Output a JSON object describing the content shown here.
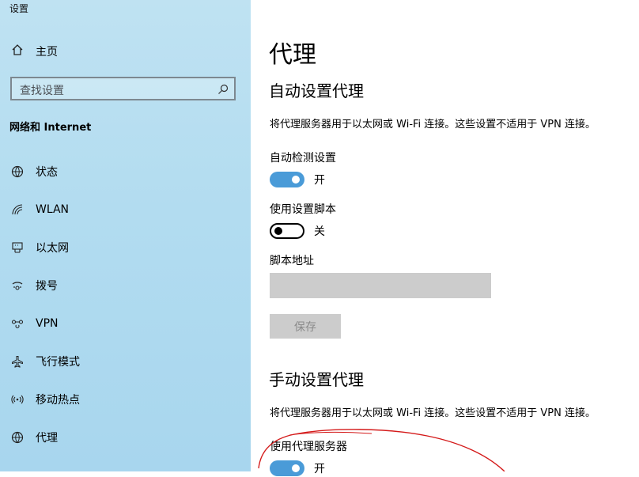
{
  "window": {
    "title": "设置"
  },
  "sidebar": {
    "home_label": "主页",
    "search_placeholder": "查找设置",
    "section_title": "网络和 Internet",
    "items": [
      {
        "label": "状态",
        "icon": "globe-icon"
      },
      {
        "label": "WLAN",
        "icon": "wifi-icon"
      },
      {
        "label": "以太网",
        "icon": "ethernet-icon"
      },
      {
        "label": "拨号",
        "icon": "dialup-icon"
      },
      {
        "label": "VPN",
        "icon": "vpn-icon"
      },
      {
        "label": "飞行模式",
        "icon": "airplane-icon"
      },
      {
        "label": "移动热点",
        "icon": "hotspot-icon"
      },
      {
        "label": "代理",
        "icon": "globe-icon",
        "selected": true
      }
    ]
  },
  "main": {
    "title": "代理",
    "auto": {
      "heading": "自动设置代理",
      "description": "将代理服务器用于以太网或 Wi-Fi 连接。这些设置不适用于 VPN 连接。",
      "detect_label": "自动检测设置",
      "detect_state": "开",
      "detect_on": true,
      "script_label": "使用设置脚本",
      "script_state": "关",
      "script_on": false,
      "address_label": "脚本地址",
      "address_value": "",
      "save_label": "保存"
    },
    "manual": {
      "heading": "手动设置代理",
      "description": "将代理服务器用于以太网或 Wi-Fi 连接。这些设置不适用于 VPN 连接。",
      "proxy_label": "使用代理服务器",
      "proxy_state": "开",
      "proxy_on": true
    }
  },
  "colors": {
    "accent": "#4a9bd8",
    "sidebar_bg": "#b2dcf0",
    "annotation": "#d41a1a",
    "disabled": "#cccccc"
  }
}
